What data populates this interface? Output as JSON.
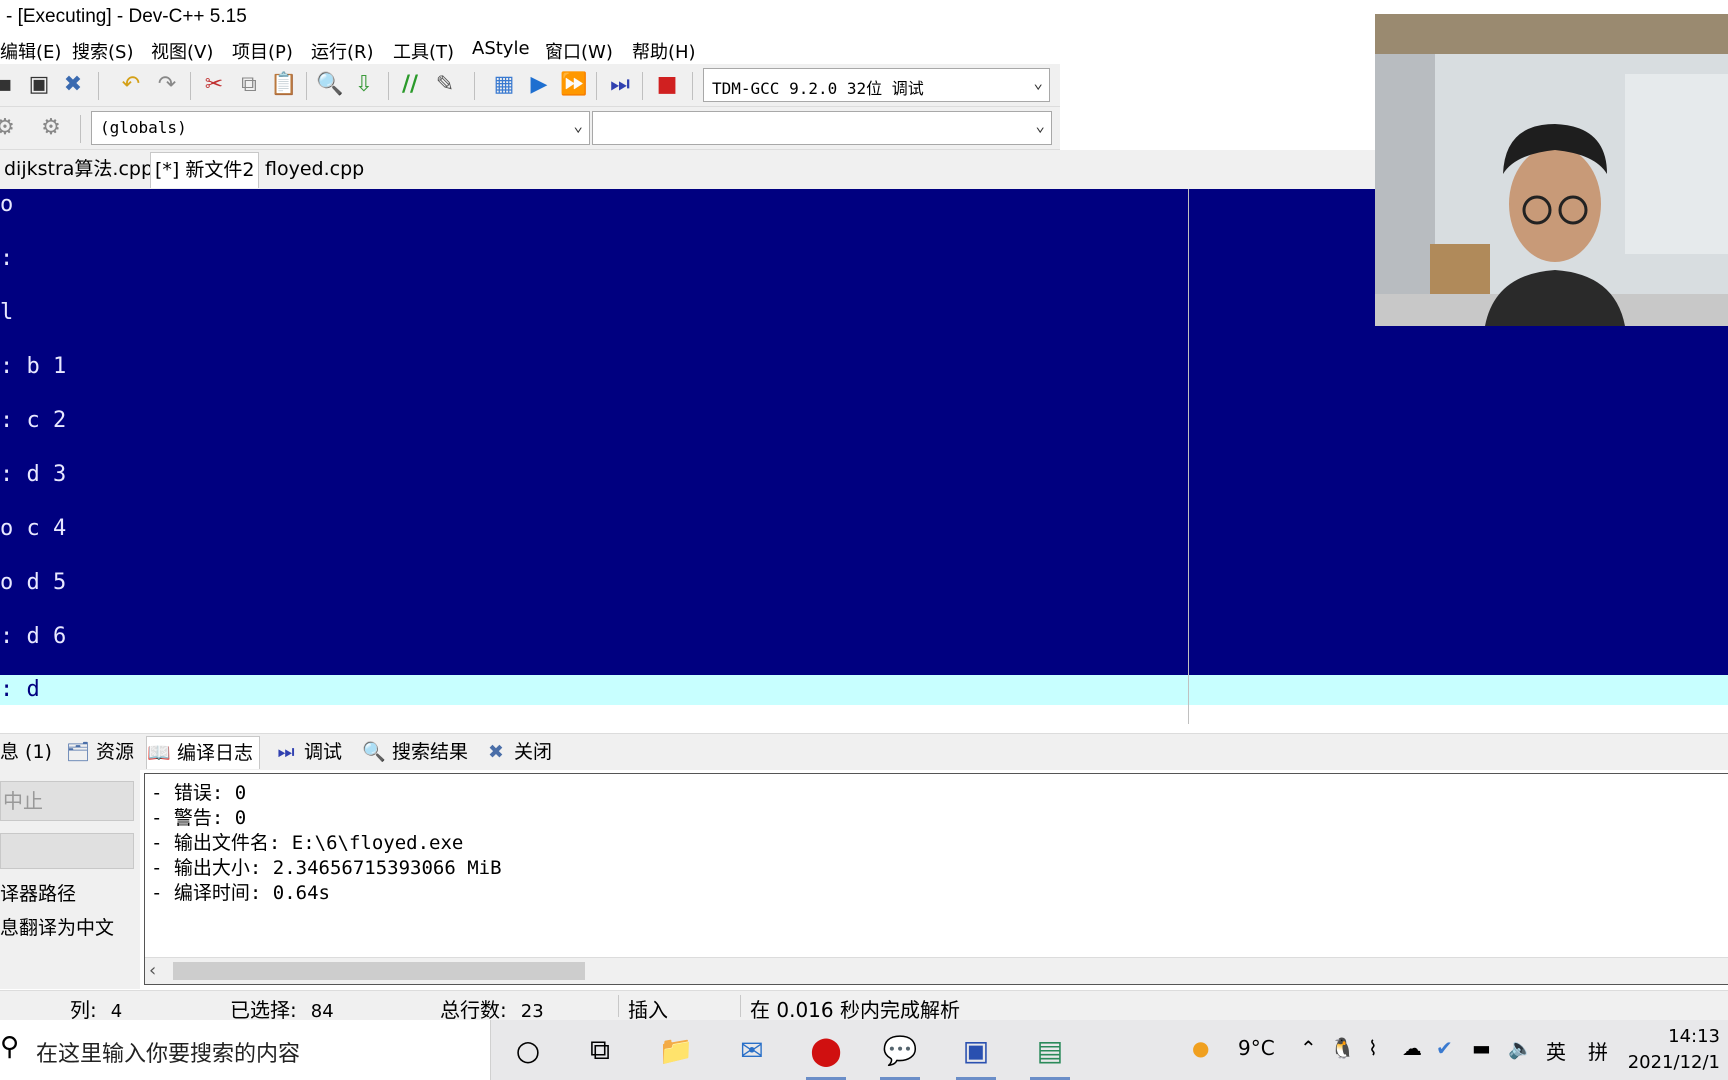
{
  "window": {
    "title": "- [Executing] - Dev-C++ 5.15"
  },
  "menu": [
    "编辑(E)",
    "搜索(S)",
    "视图(V)",
    "项目(P)",
    "运行(R)",
    "工具(T)",
    "AStyle",
    "窗口(W)",
    "帮助(H)"
  ],
  "toolbar": {
    "compiler": "TDM-GCC 9.2.0 32位  调试",
    "scope": "(globals)",
    "member": ""
  },
  "editor_tabs": [
    "dijkstra算法.cpp",
    "[*] 新文件2",
    "floyed.cpp"
  ],
  "editor": {
    "lines": [
      "o",
      ":",
      "l",
      ": b 1",
      ": c 2",
      ": d 3",
      "o c 4",
      "o d 5",
      ": d 6"
    ],
    "current_line": ": d"
  },
  "bottom_tabs": [
    "息 (1)",
    "资源",
    "编译日志",
    "调试",
    "搜索结果",
    "关闭"
  ],
  "left_panel": {
    "abort_button": "中止",
    "option1": "译器路径",
    "option2": "息翻译为中文"
  },
  "log": [
    "- 错误: 0",
    "- 警告: 0",
    "- 输出文件名: E:\\6\\floyed.exe",
    "- 输出大小: 2.34656715393066 MiB",
    "- 编译时间: 0.64s"
  ],
  "status": {
    "col_label": "列:",
    "col_value": "4",
    "sel_label": "已选择:",
    "sel_value": "84",
    "lines_label": "总行数:",
    "lines_value": "23",
    "mode": "插入",
    "parse": "在 0.016 秒内完成解析"
  },
  "taskbar": {
    "search_placeholder": "在这里输入你要搜索的内容",
    "weather": "9°C",
    "ime1": "英",
    "ime2": "拼",
    "time": "14:13",
    "date": "2021/12/1"
  }
}
